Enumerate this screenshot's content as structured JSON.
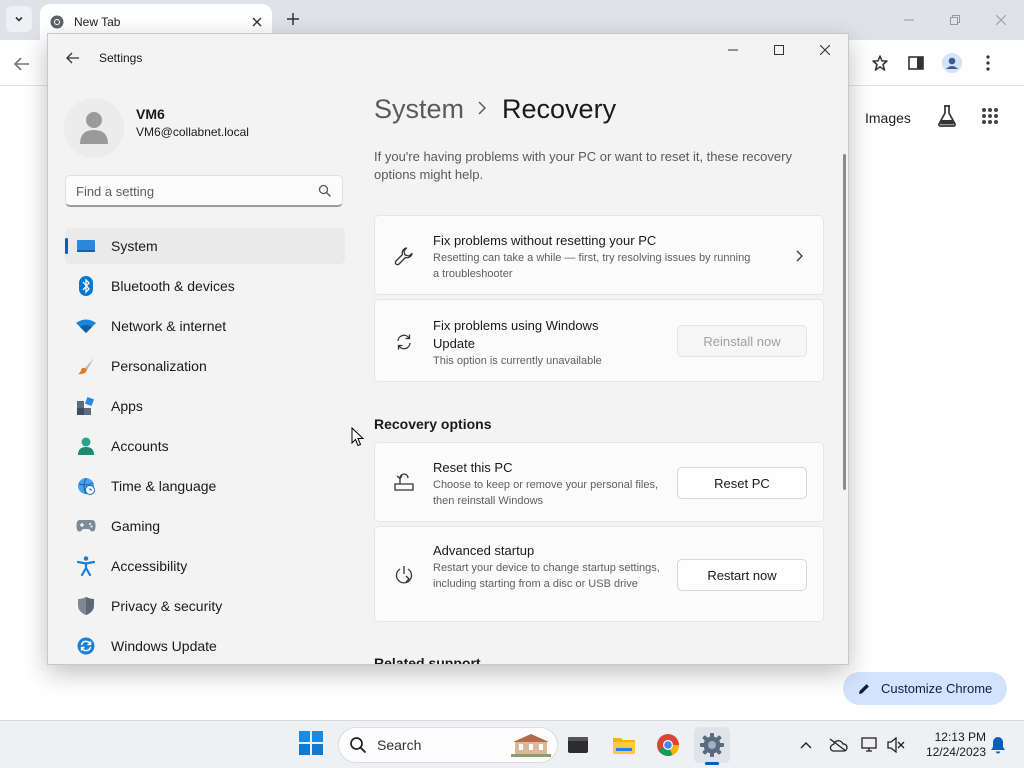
{
  "browser": {
    "tab_title": "New Tab",
    "ntp_images_link": "Images",
    "customize_chrome_label": "Customize Chrome"
  },
  "settings": {
    "app_title": "Settings",
    "user": {
      "name": "VM6",
      "email": "VM6@collabnet.local"
    },
    "search_placeholder": "Find a setting",
    "nav_items": [
      {
        "label": "System",
        "icon": "system-icon",
        "selected": true
      },
      {
        "label": "Bluetooth & devices",
        "icon": "bluetooth-icon"
      },
      {
        "label": "Network & internet",
        "icon": "wifi-icon"
      },
      {
        "label": "Personalization",
        "icon": "brush-icon"
      },
      {
        "label": "Apps",
        "icon": "apps-icon"
      },
      {
        "label": "Accounts",
        "icon": "person-icon"
      },
      {
        "label": "Time & language",
        "icon": "globe-clock-icon"
      },
      {
        "label": "Gaming",
        "icon": "gamepad-icon"
      },
      {
        "label": "Accessibility",
        "icon": "accessibility-icon"
      },
      {
        "label": "Privacy & security",
        "icon": "shield-icon"
      },
      {
        "label": "Windows Update",
        "icon": "update-icon"
      }
    ],
    "breadcrumb": {
      "parent": "System",
      "current": "Recovery"
    },
    "intro": "If you're having problems with your PC or want to reset it, these recovery options might help.",
    "cards": {
      "fix_without_reset": {
        "title": "Fix problems without resetting your PC",
        "desc": "Resetting can take a while — first, try resolving issues by running a troubleshooter"
      },
      "fix_windows_update": {
        "title": "Fix problems using Windows Update",
        "desc": "This option is currently unavailable",
        "button": "Reinstall now"
      },
      "reset_pc": {
        "title": "Reset this PC",
        "desc": "Choose to keep or remove your personal files, then reinstall Windows",
        "button": "Reset PC"
      },
      "advanced_startup": {
        "title": "Advanced startup",
        "desc": "Restart your device to change startup settings, including starting from a disc or USB drive",
        "button": "Restart now"
      }
    },
    "recovery_options_heading": "Recovery options",
    "related_support_heading": "Related support"
  },
  "taskbar": {
    "search_label": "Search",
    "time": "12:13 PM",
    "date": "12/24/2023"
  },
  "colors": {
    "accent": "#005fb8",
    "customize_chrome_bg": "#d3e3fd"
  }
}
